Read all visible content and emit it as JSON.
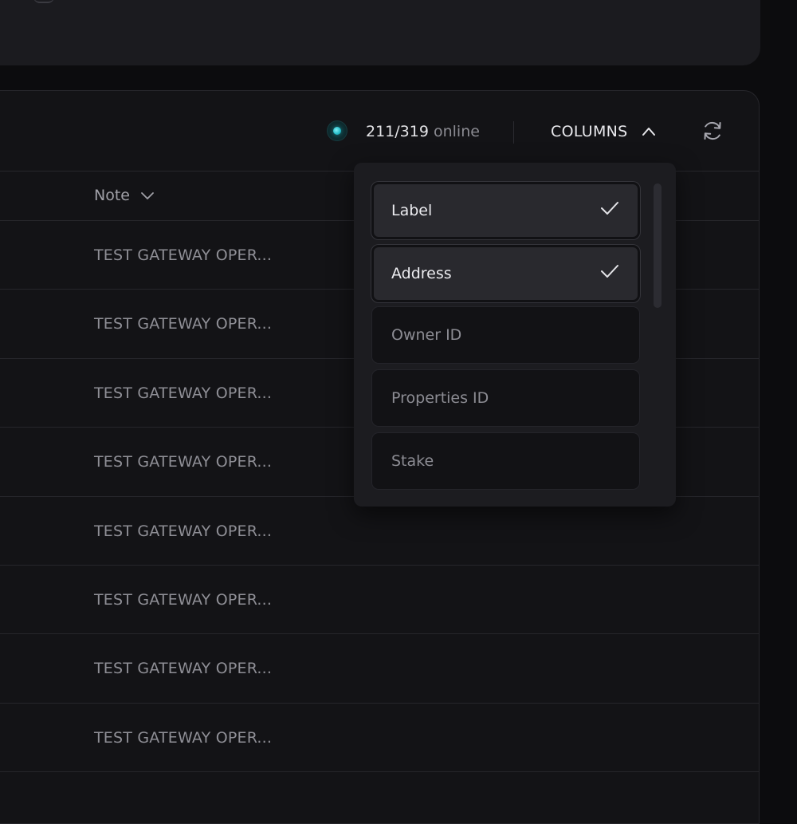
{
  "status": {
    "count": "211/319",
    "label": "online",
    "dot_color": "#22b9c6"
  },
  "toolbar": {
    "columns_label": "COLUMNS",
    "columns_icon": "chevron-up-icon",
    "refresh_icon": "refresh-icon"
  },
  "table": {
    "columns": [
      {
        "label": "Note",
        "sort_icon": "chevron-down-icon"
      }
    ],
    "rows": [
      {
        "note": "TEST GATEWAY OPER..."
      },
      {
        "note": "TEST GATEWAY OPER..."
      },
      {
        "note": "TEST GATEWAY OPER..."
      },
      {
        "note": "TEST GATEWAY OPER..."
      },
      {
        "note": "TEST GATEWAY OPER..."
      },
      {
        "note": "TEST GATEWAY OPER..."
      },
      {
        "note": "TEST GATEWAY OPER..."
      },
      {
        "note": "TEST GATEWAY OPER..."
      }
    ]
  },
  "columns_menu": {
    "options": [
      {
        "label": "Label",
        "checked": true
      },
      {
        "label": "Address",
        "checked": true
      },
      {
        "label": "Owner ID",
        "checked": false
      },
      {
        "label": "Properties ID",
        "checked": false
      },
      {
        "label": "Stake",
        "checked": false
      }
    ]
  }
}
